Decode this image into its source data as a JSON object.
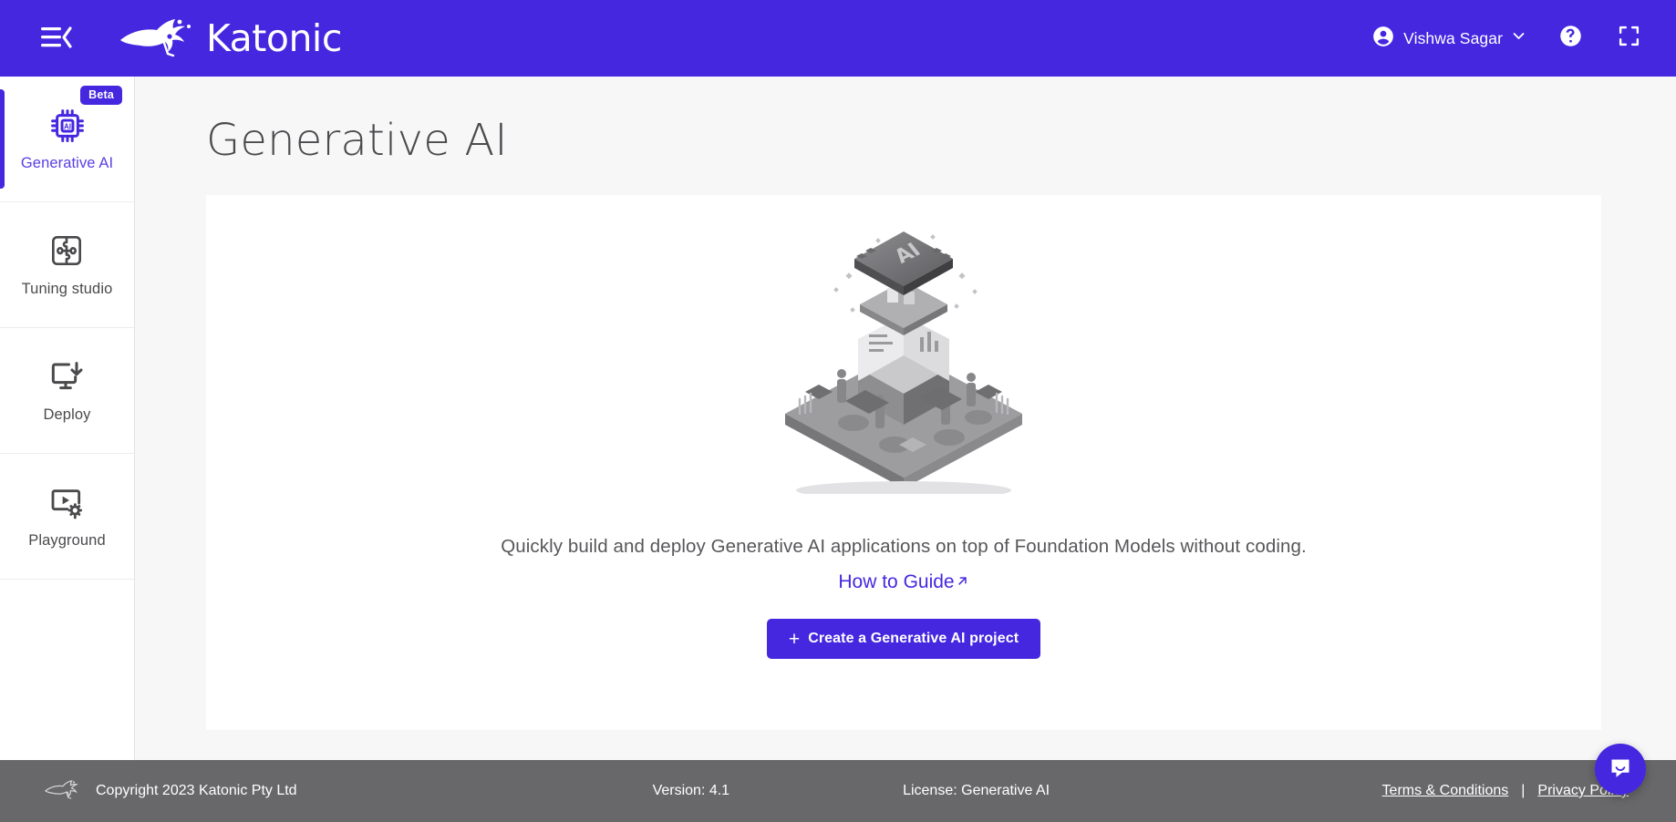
{
  "colors": {
    "brand_purple": "#4527e0",
    "footer_gray": "#68686b",
    "page_bg": "#f7f7f8",
    "card_bg": "#ffffff",
    "title_gray": "#4b4b4e"
  },
  "header": {
    "menu_icon": "menu-collapse-icon",
    "logo_icon": "kangaroo-logo-icon",
    "brand_name": "Katonic",
    "user": {
      "avatar_icon": "account-circle-icon",
      "name": "Vishwa Sagar",
      "chevron_icon": "chevron-down-icon"
    },
    "help_icon": "help-circle-icon",
    "fullscreen_icon": "fullscreen-expand-icon"
  },
  "sidebar": {
    "items": [
      {
        "label": "Generative AI",
        "icon": "ai-chip-icon",
        "badge": "Beta",
        "active": true
      },
      {
        "label": "Tuning studio",
        "icon": "puzzle-pieces-icon",
        "badge": null,
        "active": false
      },
      {
        "label": "Deploy",
        "icon": "monitor-download-icon",
        "badge": null,
        "active": false
      },
      {
        "label": "Playground",
        "icon": "play-screen-gear-icon",
        "badge": null,
        "active": false
      }
    ]
  },
  "main": {
    "page_title": "Generative AI",
    "illustration_name": "isometric-ai-platform-illustration",
    "tagline": "Quickly build and deploy Generative AI applications on top of Foundation Models without coding.",
    "how_to_guide_label": "How to Guide",
    "how_to_guide_icon": "external-link-arrow-icon",
    "cta_plus": "+",
    "cta_label": "Create a Generative AI project"
  },
  "footer": {
    "logo_icon": "kangaroo-logo-icon",
    "copyright": "Copyright 2023 Katonic Pty Ltd",
    "version": "Version: 4.1",
    "license": "License: Generative AI",
    "terms_label": "Terms & Conditions",
    "separator": "|",
    "privacy_label": "Privacy Policy"
  },
  "chat": {
    "fab_icon": "chat-bubble-smile-icon"
  }
}
